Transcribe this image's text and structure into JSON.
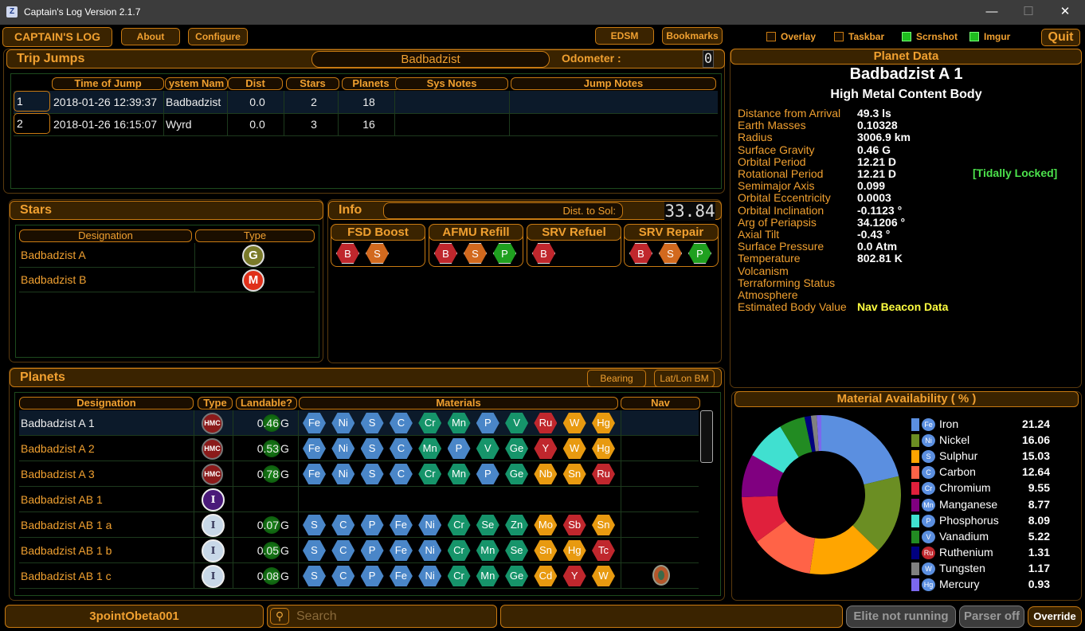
{
  "window": {
    "title": "Captain's Log Version 2.1.7",
    "min": "—",
    "max": "☐",
    "close": "✕"
  },
  "toolbar": {
    "logo": "CAPTAIN'S LOG",
    "about": "About",
    "configure": "Configure",
    "edsm": "EDSM",
    "bookmarks": "Bookmarks",
    "overlay": "Overlay",
    "taskbar": "Taskbar",
    "scrnshot": "Scrnshot",
    "imgur": "Imgur",
    "quit": "Quit"
  },
  "checks": {
    "overlay": false,
    "taskbar": false,
    "scrnshot": true,
    "imgur": true
  },
  "trip": {
    "title": "Trip Jumps",
    "system": "Badbadzist",
    "odometer_label": "Odometer :",
    "odometer_value": "0",
    "columns": [
      "Time of Jump",
      "ystem Nam",
      "Dist",
      "Stars",
      "Planets",
      "Sys Notes",
      "Jump Notes"
    ],
    "rows": [
      [
        "1",
        "2018-01-26 12:39:37",
        "Badbadzist",
        "0.0",
        "2",
        "18"
      ],
      [
        "2",
        "2018-01-26 16:15:07",
        "Wyrd",
        "0.0",
        "3",
        "16"
      ]
    ]
  },
  "stars": {
    "title": "Stars",
    "col_designation": "Designation",
    "col_type": "Type",
    "rows": [
      {
        "name": "Badbadzist A",
        "type": "G",
        "color": "#7a7a2a"
      },
      {
        "name": "Badbadzist B",
        "type": "M",
        "color": "#e0301a"
      }
    ]
  },
  "info": {
    "title": "Info",
    "dist_label": "Dist. to Sol:",
    "dist_value": "33.84",
    "groups": [
      {
        "label": "FSD Boost",
        "items": [
          "B",
          "S"
        ]
      },
      {
        "label": "AFMU Refill",
        "items": [
          "B",
          "S",
          "P"
        ]
      },
      {
        "label": "SRV Refuel",
        "items": [
          "B"
        ]
      },
      {
        "label": "SRV Repair",
        "items": [
          "B",
          "S",
          "P"
        ]
      }
    ]
  },
  "planets": {
    "title": "Planets",
    "bearing": "Bearing",
    "latlon": "Lat/Lon BM",
    "columns": [
      "Designation",
      "Type",
      "Landable?",
      "Materials",
      "Nav"
    ],
    "rows": [
      {
        "name": "Badbadzist A 1",
        "type": "HMC",
        "g": "0.46",
        "unit": "G",
        "mats": [
          "Fe",
          "Ni",
          "S",
          "C",
          "Cr",
          "Mn",
          "P",
          "V",
          "Ru",
          "W",
          "Hg"
        ]
      },
      {
        "name": "Badbadzist A 2",
        "type": "HMC",
        "g": "0.53",
        "unit": "G",
        "mats": [
          "Fe",
          "Ni",
          "S",
          "C",
          "Mn",
          "P",
          "V",
          "Ge",
          "Y",
          "W",
          "Hg"
        ]
      },
      {
        "name": "Badbadzist A 3",
        "type": "HMC",
        "g": "0.78",
        "unit": "G",
        "mats": [
          "Fe",
          "Ni",
          "S",
          "C",
          "Cr",
          "Mn",
          "P",
          "Ge",
          "Nb",
          "Sn",
          "Ru"
        ]
      },
      {
        "name": "Badbadzist AB 1",
        "type": "I",
        "g": "",
        "unit": "",
        "mats": []
      },
      {
        "name": "Badbadzist AB 1 a",
        "type": "I",
        "g": "0.07",
        "unit": "G",
        "mats": [
          "S",
          "C",
          "P",
          "Fe",
          "Ni",
          "Cr",
          "Se",
          "Zn",
          "Mo",
          "Sb",
          "Sn"
        ]
      },
      {
        "name": "Badbadzist AB 1 b",
        "type": "I",
        "g": "0.05",
        "unit": "G",
        "mats": [
          "S",
          "C",
          "P",
          "Fe",
          "Ni",
          "Cr",
          "Mn",
          "Se",
          "Sn",
          "Hg",
          "Tc"
        ]
      },
      {
        "name": "Badbadzist AB 1 c",
        "type": "I",
        "g": "0.08",
        "unit": "G",
        "mats": [
          "S",
          "C",
          "P",
          "Fe",
          "Ni",
          "Cr",
          "Mn",
          "Ge",
          "Cd",
          "Y",
          "W"
        ],
        "nav": true
      }
    ]
  },
  "planet_data": {
    "title": "Planet Data",
    "name": "Badbadzist A 1",
    "subtitle": "High Metal Content Body",
    "props": [
      [
        "Distance from Arrival",
        "49.3 ls"
      ],
      [
        "Earth Masses",
        "0.10328"
      ],
      [
        "Radius",
        "3006.9 km"
      ],
      [
        "Surface Gravity",
        "0.46 G"
      ],
      [
        "Orbital Period",
        "12.21 D"
      ],
      [
        "Rotational  Period",
        "12.21 D"
      ],
      [
        "Semimajor Axis",
        "0.099"
      ],
      [
        "Orbital Eccentricity",
        "0.0003"
      ],
      [
        "Orbital Inclination",
        "-0.1123 °"
      ],
      [
        "Arg of Periapsis",
        "34.1206 °"
      ],
      [
        "Axial Tilt",
        "-0.43 °"
      ],
      [
        "Surface Pressure",
        "0.0 Atm"
      ],
      [
        "Temperature",
        "802.81 K"
      ],
      [
        "Volcanism",
        ""
      ],
      [
        "Terraforming Status",
        ""
      ],
      [
        "Atmosphere",
        ""
      ],
      [
        "Estimated Body Value",
        "Nav Beacon Data"
      ]
    ],
    "tidal": "[Tidally Locked]"
  },
  "chart_data": {
    "type": "pie",
    "title": "Material Availability ( % )",
    "categories": [
      "Iron",
      "Nickel",
      "Sulphur",
      "Carbon",
      "Chromium",
      "Manganese",
      "Phosphorus",
      "Vanadium",
      "Ruthenium",
      "Tungsten",
      "Mercury"
    ],
    "symbols": [
      "Fe",
      "Ni",
      "S",
      "C",
      "Cr",
      "Mn",
      "P",
      "V",
      "Ru",
      "W",
      "Hg"
    ],
    "values": [
      21.24,
      16.06,
      15.03,
      12.64,
      9.55,
      8.77,
      8.09,
      5.22,
      1.31,
      1.17,
      0.93
    ],
    "value_labels": [
      "21.24",
      "16.06",
      "15.03",
      "12.64",
      "9.55",
      "8.77",
      "8.09",
      "5.22",
      "1.31",
      "1.17",
      "0.93"
    ],
    "colors": [
      "#5b8fe0",
      "#6b8e23",
      "#ffa500",
      "#ff6347",
      "#e0203c",
      "#800080",
      "#40e0d0",
      "#228b22",
      "#000080",
      "#808080",
      "#7b68ee"
    ]
  },
  "status": {
    "commander": "3pointObeta001",
    "search_placeholder": "Search",
    "elite": "Elite not running",
    "parser": "Parser off",
    "override": "Override"
  }
}
